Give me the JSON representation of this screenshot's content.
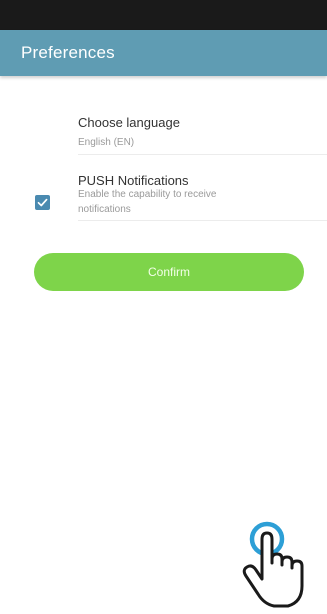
{
  "header": {
    "title": "Preferences"
  },
  "preferences": {
    "language": {
      "title": "Choose language",
      "value": "English (EN)"
    },
    "push": {
      "title": "PUSH Notifications",
      "description": "Enable the capability to receive notifications",
      "checked": true
    }
  },
  "actions": {
    "confirm_label": "Confirm"
  },
  "colors": {
    "app_bar": "#5f9cb3",
    "status_bar": "#1a1a1a",
    "checkbox": "#4a8ab0",
    "confirm": "#7ed44a",
    "tap_ring": "#2d9fd6"
  },
  "icons": {
    "check": "checkmark-icon",
    "tap": "hand-pointer-icon"
  }
}
